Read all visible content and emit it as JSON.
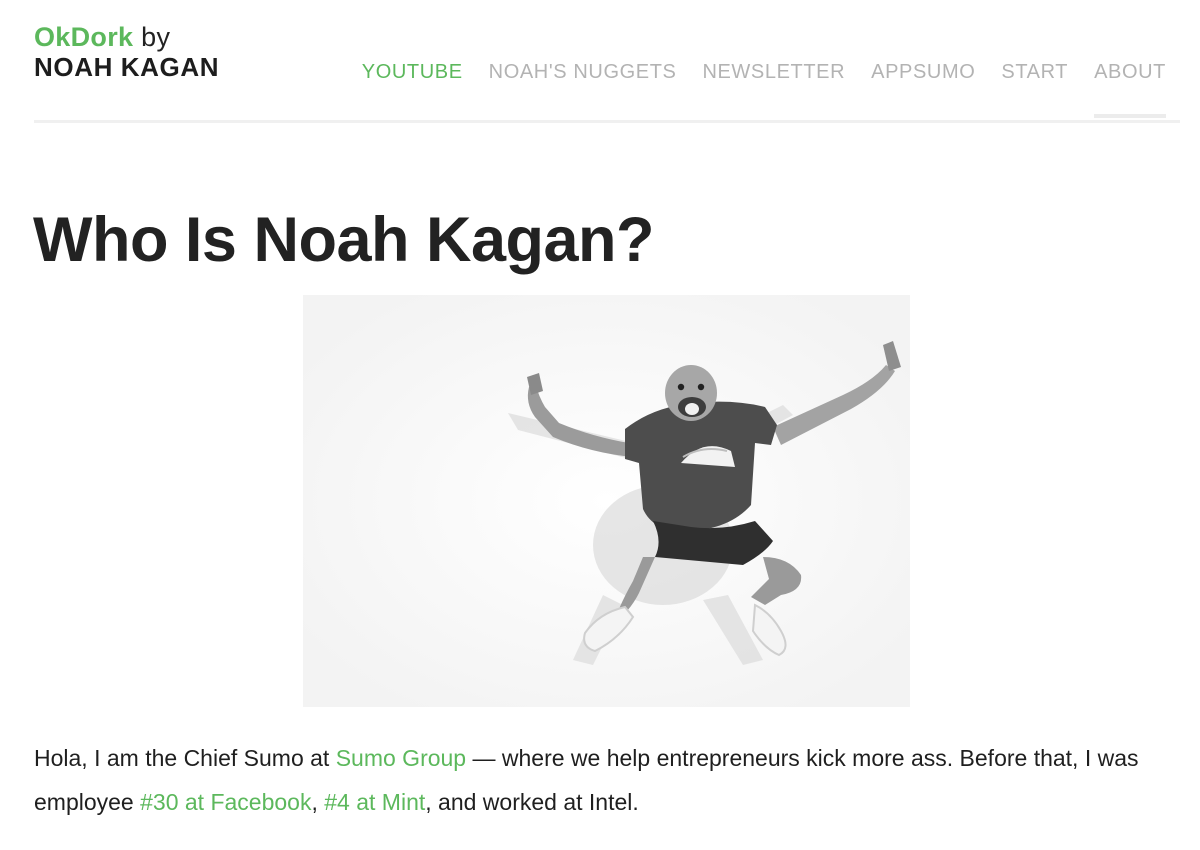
{
  "brand": {
    "name": "OkDork",
    "by": "by",
    "author": "NOAH KAGAN",
    "accent": "#5cb85c"
  },
  "nav": [
    {
      "label": "YOUTUBE",
      "active": true
    },
    {
      "label": "NOAH'S NUGGETS"
    },
    {
      "label": "NEWSLETTER"
    },
    {
      "label": "APPSUMO"
    },
    {
      "label": "START"
    },
    {
      "label": "ABOUT",
      "current": true
    }
  ],
  "page": {
    "title": "Who Is Noah Kagan?"
  },
  "hero": {
    "icon": "person-jumping-photo"
  },
  "intro": {
    "t1": "Hola, I am the Chief Sumo at ",
    "link1": "Sumo Group",
    "t2": " — where we help entrepreneurs kick more ass. Before that, I was employee ",
    "link2": "#30 at Facebook",
    "t3": ", ",
    "link3": "#4 at Mint",
    "t4": ", and worked at Intel."
  }
}
